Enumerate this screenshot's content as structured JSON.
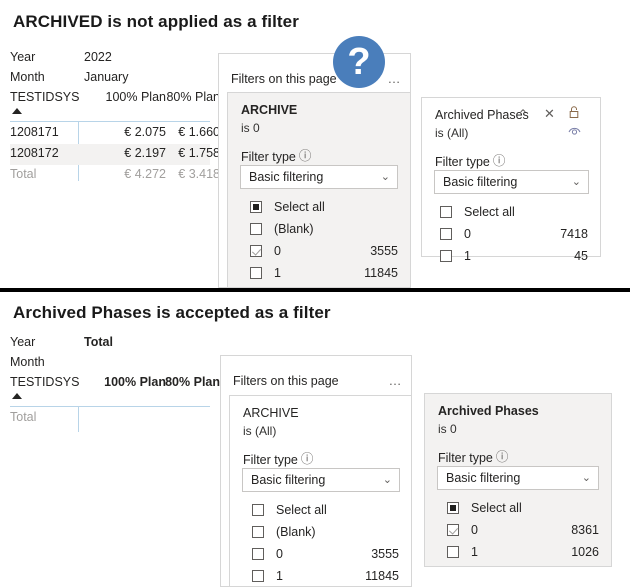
{
  "sections": [
    {
      "title": "ARCHIVED is not applied as a filter",
      "matrix": {
        "header_rows": [
          {
            "label": "Year",
            "value": "2022"
          },
          {
            "label": "Month",
            "value": "January"
          }
        ],
        "columns": [
          "TESTIDSYS",
          "100% Plan",
          "80% Plan"
        ],
        "rows": [
          {
            "key": "1208171",
            "c1": "€ 2.075",
            "c2": "€ 1.660"
          },
          {
            "key": "1208172",
            "c1": "€ 2.197",
            "c2": "€ 1.758"
          }
        ],
        "total_row": {
          "key": "Total",
          "c1": "€ 4.272",
          "c2": "€ 3.418"
        }
      },
      "pane": {
        "header": "Filters on this page",
        "more_menu": "…"
      },
      "cards": [
        {
          "title": "ARCHIVE",
          "subtitle": "is 0",
          "filter_type_label": "Filter type",
          "info_glyph": "ⓘ",
          "filter_type_value": "Basic filtering",
          "chevron": "⌄",
          "options": [
            {
              "label": "Select all",
              "count": "",
              "state": "indeterminate"
            },
            {
              "label": "(Blank)",
              "count": "",
              "state": "unchecked"
            },
            {
              "label": "0",
              "count": "3555",
              "state": "checked"
            },
            {
              "label": "1",
              "count": "11845",
              "state": "unchecked"
            }
          ]
        },
        {
          "title": "Archived Phases",
          "subtitle": "is (All)",
          "filter_type_label": "Filter type",
          "info_glyph": "ⓘ",
          "filter_type_value": "Basic filtering",
          "chevron": "⌄",
          "icons": {
            "collapse": "⌃",
            "close": "✕",
            "lock": "lock-icon",
            "eye": "eye-icon"
          },
          "options": [
            {
              "label": "Select all",
              "count": "",
              "state": "unchecked"
            },
            {
              "label": "0",
              "count": "7418",
              "state": "unchecked"
            },
            {
              "label": "1",
              "count": "45",
              "state": "unchecked"
            }
          ]
        }
      ],
      "help_badge": "?"
    },
    {
      "title": "Archived Phases is accepted as a filter",
      "matrix": {
        "header_rows": [
          {
            "label": "Year",
            "value": "Total"
          },
          {
            "label": "Month",
            "value": ""
          }
        ],
        "columns": [
          "TESTIDSYS",
          "100% Plan",
          "80% Plan"
        ],
        "rows": [],
        "total_row": {
          "key": "Total",
          "c1": "",
          "c2": ""
        }
      },
      "pane": {
        "header": "Filters on this page",
        "more_menu": "…"
      },
      "cards": [
        {
          "title": "ARCHIVE",
          "subtitle": "is (All)",
          "filter_type_label": "Filter type",
          "info_glyph": "ⓘ",
          "filter_type_value": "Basic filtering",
          "chevron": "⌄",
          "options": [
            {
              "label": "Select all",
              "count": "",
              "state": "unchecked"
            },
            {
              "label": "(Blank)",
              "count": "",
              "state": "unchecked"
            },
            {
              "label": "0",
              "count": "3555",
              "state": "unchecked"
            },
            {
              "label": "1",
              "count": "11845",
              "state": "unchecked"
            }
          ]
        },
        {
          "title": "Archived Phases",
          "subtitle": "is 0",
          "filter_type_label": "Filter type",
          "info_glyph": "ⓘ",
          "filter_type_value": "Basic filtering",
          "chevron": "⌄",
          "options": [
            {
              "label": "Select all",
              "count": "",
              "state": "indeterminate"
            },
            {
              "label": "0",
              "count": "8361",
              "state": "checked"
            },
            {
              "label": "1",
              "count": "1026",
              "state": "unchecked"
            }
          ]
        }
      ]
    }
  ],
  "colors": {
    "badge_blue": "#4a7ebb",
    "rule_blue": "#b8d4e8",
    "card_gray": "#f3f2f1",
    "muted_text": "#a19f9d"
  }
}
